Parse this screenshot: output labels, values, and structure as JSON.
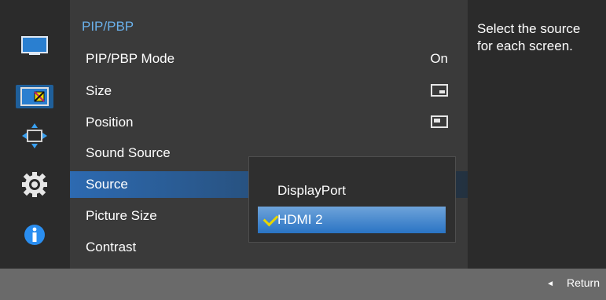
{
  "header": {
    "title": "PIP/PBP"
  },
  "menu": [
    {
      "label": "PIP/PBP Mode",
      "value": "On"
    },
    {
      "label": "Size",
      "value": ""
    },
    {
      "label": "Position",
      "value": ""
    },
    {
      "label": "Sound Source",
      "value": ""
    },
    {
      "label": "Source",
      "value": "",
      "selected": true
    },
    {
      "label": "Picture Size",
      "value": ""
    },
    {
      "label": "Contrast",
      "value": ""
    }
  ],
  "source_dropdown": {
    "options": [
      "DisplayPort",
      "HDMI 2"
    ],
    "selected": "HDMI 2"
  },
  "help": {
    "text": "Select the source for each screen."
  },
  "footer": {
    "return_label": "Return"
  },
  "sidebar": {
    "icons": [
      "picture-icon",
      "pip-icon",
      "position-icon",
      "settings-gear-icon",
      "info-icon"
    ],
    "active_index": 1
  },
  "colors": {
    "accent": "#1f5f9a",
    "header": "#6ab0ea",
    "check": "#e8d700"
  }
}
